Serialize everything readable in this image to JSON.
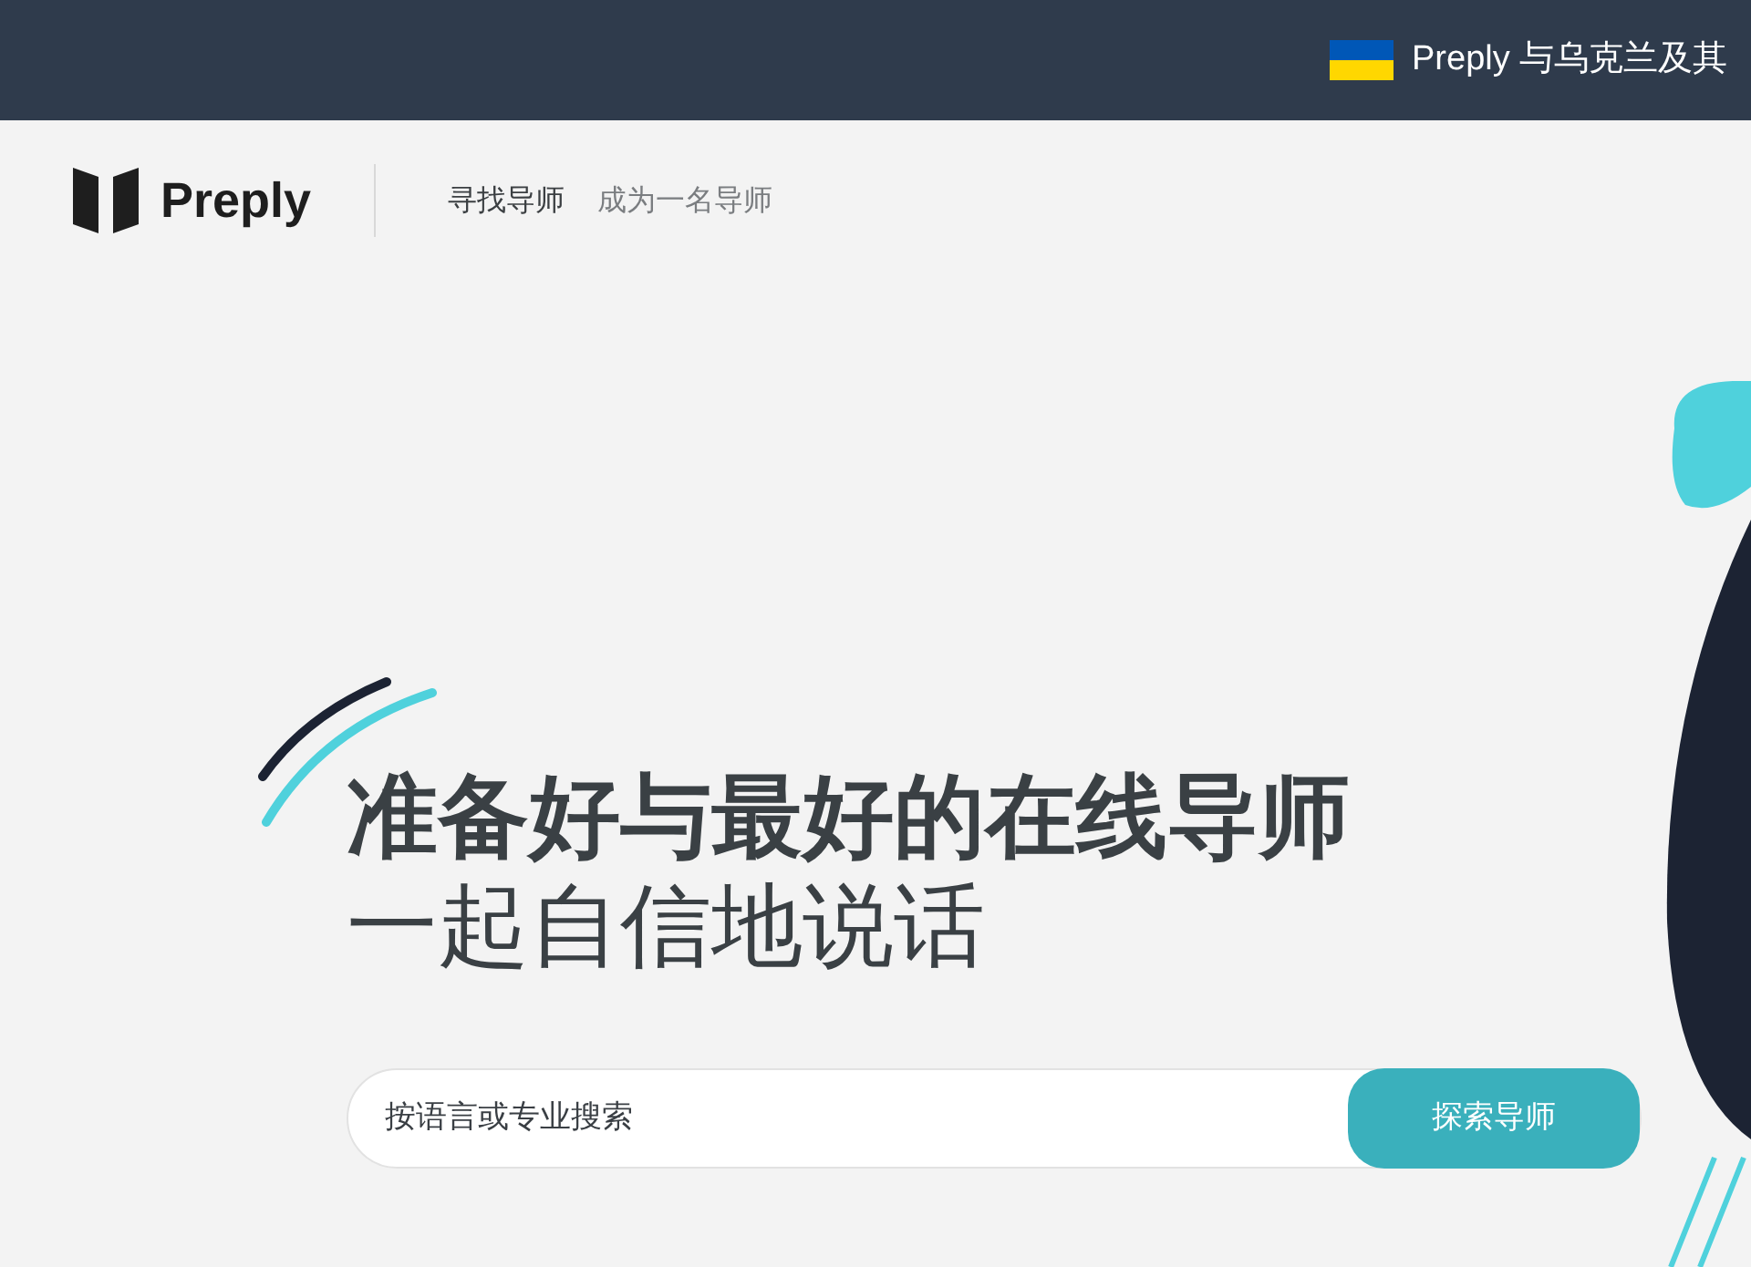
{
  "banner": {
    "text": "Preply 与乌克兰及其"
  },
  "header": {
    "logo_text": "Preply",
    "nav": [
      "寻找导师",
      "成为一名导师"
    ]
  },
  "hero": {
    "title": "准备好与最好的在线导师",
    "subtitle": "一起自信地说话"
  },
  "search": {
    "placeholder": "按语言或专业搜索",
    "button": "探索导师"
  }
}
